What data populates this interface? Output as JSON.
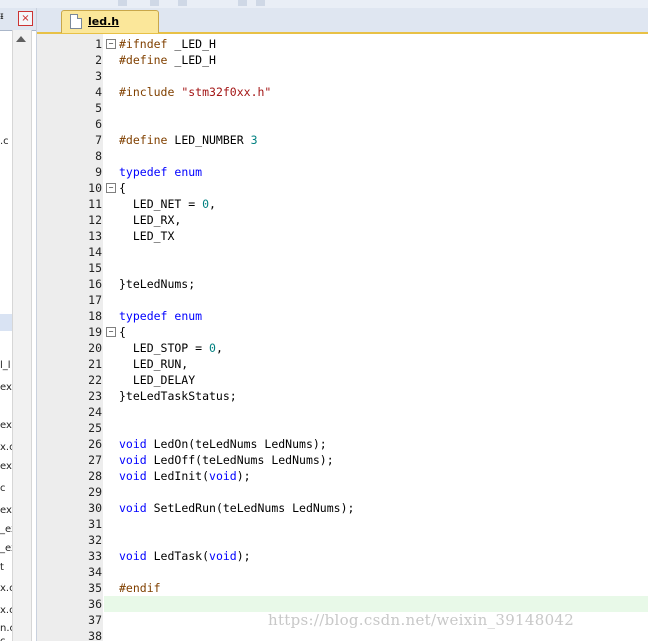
{
  "left_panel": {
    "pin_label": "ᵻ",
    "close_label": "×",
    "items": [
      ".c",
      "l_l",
      "ex.",
      "ex.",
      "x.c",
      "ex.",
      "c",
      "ex.",
      "_ex",
      "_ex",
      "t",
      "x.c",
      "x.c",
      "n.c",
      "c"
    ]
  },
  "tab": {
    "label": "led.h"
  },
  "editor": {
    "lines": [
      {
        "n": "1",
        "fold": "−",
        "tokens": [
          {
            "c": "kw-pp",
            "t": "#ifndef"
          },
          {
            "c": "txt",
            "t": " _LED_H"
          }
        ]
      },
      {
        "n": "2",
        "tokens": [
          {
            "c": "kw-pp",
            "t": "#define"
          },
          {
            "c": "txt",
            "t": " _LED_H"
          }
        ]
      },
      {
        "n": "3",
        "tokens": []
      },
      {
        "n": "4",
        "tokens": [
          {
            "c": "kw-pp",
            "t": "#include"
          },
          {
            "c": "txt",
            "t": " "
          },
          {
            "c": "str",
            "t": "\"stm32f0xx.h\""
          }
        ]
      },
      {
        "n": "5",
        "tokens": []
      },
      {
        "n": "6",
        "tokens": []
      },
      {
        "n": "7",
        "tokens": [
          {
            "c": "kw-pp",
            "t": "#define"
          },
          {
            "c": "txt",
            "t": " LED_NUMBER "
          },
          {
            "c": "num",
            "t": "3"
          }
        ]
      },
      {
        "n": "8",
        "tokens": []
      },
      {
        "n": "9",
        "tokens": [
          {
            "c": "kw",
            "t": "typedef"
          },
          {
            "c": "txt",
            "t": " "
          },
          {
            "c": "kw",
            "t": "enum"
          }
        ]
      },
      {
        "n": "10",
        "fold": "−",
        "tokens": [
          {
            "c": "txt",
            "t": "{"
          }
        ]
      },
      {
        "n": "11",
        "tokens": [
          {
            "c": "txt",
            "t": "  LED_NET = "
          },
          {
            "c": "num",
            "t": "0"
          },
          {
            "c": "txt",
            "t": ","
          }
        ]
      },
      {
        "n": "12",
        "tokens": [
          {
            "c": "txt",
            "t": "  LED_RX,"
          }
        ]
      },
      {
        "n": "13",
        "tokens": [
          {
            "c": "txt",
            "t": "  LED_TX"
          }
        ]
      },
      {
        "n": "14",
        "tokens": []
      },
      {
        "n": "15",
        "tokens": []
      },
      {
        "n": "16",
        "tokens": [
          {
            "c": "txt",
            "t": "}teLedNums;"
          }
        ]
      },
      {
        "n": "17",
        "tokens": []
      },
      {
        "n": "18",
        "tokens": [
          {
            "c": "kw",
            "t": "typedef"
          },
          {
            "c": "txt",
            "t": " "
          },
          {
            "c": "kw",
            "t": "enum"
          }
        ]
      },
      {
        "n": "19",
        "fold": "−",
        "tokens": [
          {
            "c": "txt",
            "t": "{"
          }
        ]
      },
      {
        "n": "20",
        "tokens": [
          {
            "c": "txt",
            "t": "  LED_STOP = "
          },
          {
            "c": "num",
            "t": "0"
          },
          {
            "c": "txt",
            "t": ","
          }
        ]
      },
      {
        "n": "21",
        "tokens": [
          {
            "c": "txt",
            "t": "  LED_RUN,"
          }
        ]
      },
      {
        "n": "22",
        "tokens": [
          {
            "c": "txt",
            "t": "  LED_DELAY"
          }
        ]
      },
      {
        "n": "23",
        "tokens": [
          {
            "c": "txt",
            "t": "}teLedTaskStatus;"
          }
        ]
      },
      {
        "n": "24",
        "tokens": []
      },
      {
        "n": "25",
        "tokens": []
      },
      {
        "n": "26",
        "tokens": [
          {
            "c": "kw",
            "t": "void"
          },
          {
            "c": "txt",
            "t": " LedOn(teLedNums LedNums);"
          }
        ]
      },
      {
        "n": "27",
        "tokens": [
          {
            "c": "kw",
            "t": "void"
          },
          {
            "c": "txt",
            "t": " LedOff(teLedNums LedNums);"
          }
        ]
      },
      {
        "n": "28",
        "tokens": [
          {
            "c": "kw",
            "t": "void"
          },
          {
            "c": "txt",
            "t": " LedInit("
          },
          {
            "c": "kw",
            "t": "void"
          },
          {
            "c": "txt",
            "t": ");"
          }
        ]
      },
      {
        "n": "29",
        "tokens": []
      },
      {
        "n": "30",
        "tokens": [
          {
            "c": "kw",
            "t": "void"
          },
          {
            "c": "txt",
            "t": " SetLedRun(teLedNums LedNums);"
          }
        ]
      },
      {
        "n": "31",
        "tokens": []
      },
      {
        "n": "32",
        "tokens": []
      },
      {
        "n": "33",
        "tokens": [
          {
            "c": "kw",
            "t": "void"
          },
          {
            "c": "txt",
            "t": " LedTask("
          },
          {
            "c": "kw",
            "t": "void"
          },
          {
            "c": "txt",
            "t": ");"
          }
        ]
      },
      {
        "n": "34",
        "tokens": []
      },
      {
        "n": "35",
        "tokens": [
          {
            "c": "kw-pp",
            "t": "#endif"
          }
        ]
      },
      {
        "n": "36",
        "current": true,
        "tokens": []
      },
      {
        "n": "37",
        "tokens": []
      },
      {
        "n": "38",
        "tokens": []
      }
    ]
  },
  "watermark": "https://blog.csdn.net/weixin_39148042"
}
